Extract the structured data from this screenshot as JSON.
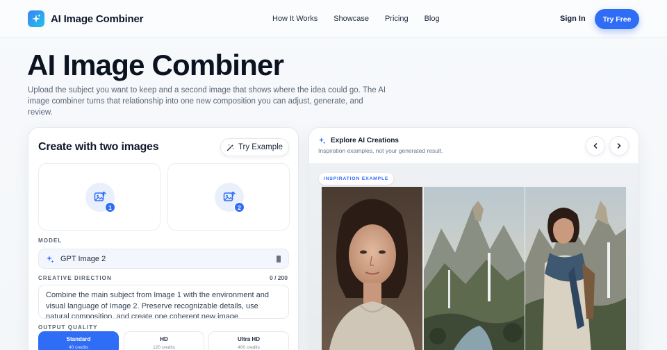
{
  "nav": {
    "brand": "AI Image Combiner",
    "links": [
      "How It Works",
      "Showcase",
      "Pricing",
      "Blog"
    ],
    "sign_in": "Sign In",
    "try_free": "Try Free"
  },
  "hero": {
    "title": "AI Image Combiner",
    "subtitle": "Upload the subject you want to keep and a second image that shows where the idea could go. The AI image combiner turns that relationship into one new composition you can adjust, generate, and review."
  },
  "create_card": {
    "title": "Create with two images",
    "try_example": "Try Example",
    "slots": [
      {
        "badge": "1",
        "icon": "image-upload-icon"
      },
      {
        "badge": "2",
        "icon": "image-upload-icon"
      }
    ],
    "model_label": "MODEL",
    "model_value": "GPT Image 2",
    "direction_label": "CREATIVE DIRECTION",
    "direction_count": "0 / 200",
    "direction_text": "Combine the main subject from Image 1 with the environment and visual language of Image 2. Preserve recognizable details, use natural composition, and create one coherent new image.",
    "quality_label": "OUTPUT QUALITY",
    "quality_options": [
      {
        "name": "Standard",
        "credits": "40 credits",
        "active": true
      },
      {
        "name": "HD",
        "credits": "120 credits",
        "active": false
      },
      {
        "name": "Ultra HD",
        "credits": "400 credits",
        "active": false
      }
    ]
  },
  "explore_card": {
    "title": "Explore AI Creations",
    "subtitle": "Inspiration examples, not your generated result.",
    "badge": "INSPIRATION EXAMPLE",
    "prev_icon": "chevron-left-icon",
    "next_icon": "chevron-right-icon"
  },
  "colors": {
    "accent": "#2f6df6",
    "text": "#0f172a",
    "muted": "#5b6778"
  }
}
